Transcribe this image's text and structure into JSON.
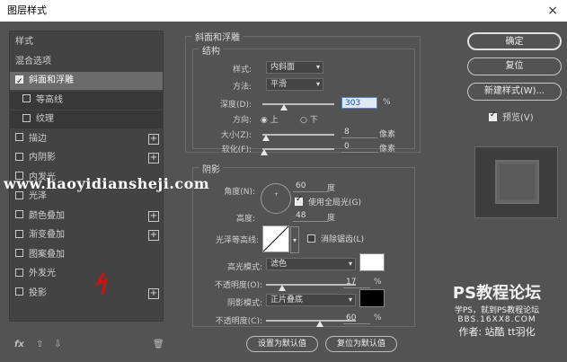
{
  "window": {
    "title": "图层样式",
    "close": "×"
  },
  "left_list": [
    {
      "label": "样式",
      "checkbox": false,
      "sub": false,
      "sel": false,
      "plus": false
    },
    {
      "label": "混合选项",
      "checkbox": false,
      "sub": false,
      "sel": false,
      "plus": false
    },
    {
      "label": "斜面和浮雕",
      "checkbox": true,
      "checked": true,
      "sub": false,
      "sel": true,
      "plus": false
    },
    {
      "label": "等高线",
      "checkbox": true,
      "checked": false,
      "sub": true,
      "sel": false,
      "plus": false
    },
    {
      "label": "纹理",
      "checkbox": true,
      "checked": false,
      "sub": true,
      "sel": false,
      "plus": false
    },
    {
      "label": "描边",
      "checkbox": true,
      "checked": false,
      "sub": false,
      "sel": false,
      "plus": true
    },
    {
      "label": "内阴影",
      "checkbox": true,
      "checked": false,
      "sub": false,
      "sel": false,
      "plus": true
    },
    {
      "label": "内发光",
      "checkbox": true,
      "checked": false,
      "sub": false,
      "sel": false,
      "plus": false
    },
    {
      "label": "光泽",
      "checkbox": true,
      "checked": false,
      "sub": false,
      "sel": false,
      "plus": false
    },
    {
      "label": "颜色叠加",
      "checkbox": true,
      "checked": false,
      "sub": false,
      "sel": false,
      "plus": true
    },
    {
      "label": "渐变叠加",
      "checkbox": true,
      "checked": false,
      "sub": false,
      "sel": false,
      "plus": true
    },
    {
      "label": "图案叠加",
      "checkbox": true,
      "checked": false,
      "sub": false,
      "sel": false,
      "plus": false
    },
    {
      "label": "外发光",
      "checkbox": true,
      "checked": false,
      "sub": false,
      "sel": false,
      "plus": false
    },
    {
      "label": "投影",
      "checkbox": true,
      "checked": false,
      "sub": false,
      "sel": false,
      "plus": true
    }
  ],
  "left_footer": {
    "fx": "fx",
    "up": "⇧",
    "down": "⇩",
    "trash": "🗑"
  },
  "bevel": {
    "group_title": "斜面和浮雕",
    "structure_title": "结构",
    "style_label": "样式:",
    "style_value": "内斜面",
    "technique_label": "方法:",
    "technique_value": "平滑",
    "depth_label": "深度(D):",
    "depth_value": "303",
    "depth_unit": "%",
    "depth_level": 0.3,
    "direction_label": "方向:",
    "dir_up": "上",
    "dir_down": "下",
    "size_label": "大小(Z):",
    "size_value": "8",
    "size_unit": "像素",
    "size_level": 0.1,
    "soften_label": "软化(F):",
    "soften_value": "0",
    "soften_unit": "像素",
    "soften_level": 0.0
  },
  "shading": {
    "title": "阴影",
    "angle_label": "角度(N):",
    "angle_value": "60",
    "angle_unit": "度",
    "global_light_label": "使用全局光(G)",
    "altitude_label": "高度:",
    "altitude_value": "48",
    "altitude_unit": "度",
    "gloss_label": "光泽等高线:",
    "antialias_label": "消除锯齿(L)",
    "highlight_mode_label": "高光模式:",
    "highlight_mode_value": "滤色",
    "highlight_color": "#ffffff",
    "hl_opacity_label": "不透明度(O):",
    "hl_opacity_value": "17",
    "hl_opacity_unit": "%",
    "hl_opacity_level": 0.17,
    "shadow_mode_label": "阴影模式:",
    "shadow_mode_value": "正片叠底",
    "shadow_color": "#000000",
    "sh_opacity_label": "不透明度(C):",
    "sh_opacity_value": "60",
    "sh_opacity_unit": "%",
    "sh_opacity_level": 0.6
  },
  "bottom_buttons": {
    "set_default": "设置为默认值",
    "reset_default": "复位为默认值"
  },
  "right": {
    "ok": "确定",
    "reset": "复位",
    "new_style": "新建样式(W)...",
    "preview_label": "预览(V)"
  },
  "watermark": {
    "url": "www.haoyidiansheji.com",
    "brand": "PS教程论坛",
    "brand_sub": "学PS，就到PS教程论坛",
    "brand_site": "BBS.16XX8.COM",
    "author": "作者: 站酷 tt羽化"
  }
}
